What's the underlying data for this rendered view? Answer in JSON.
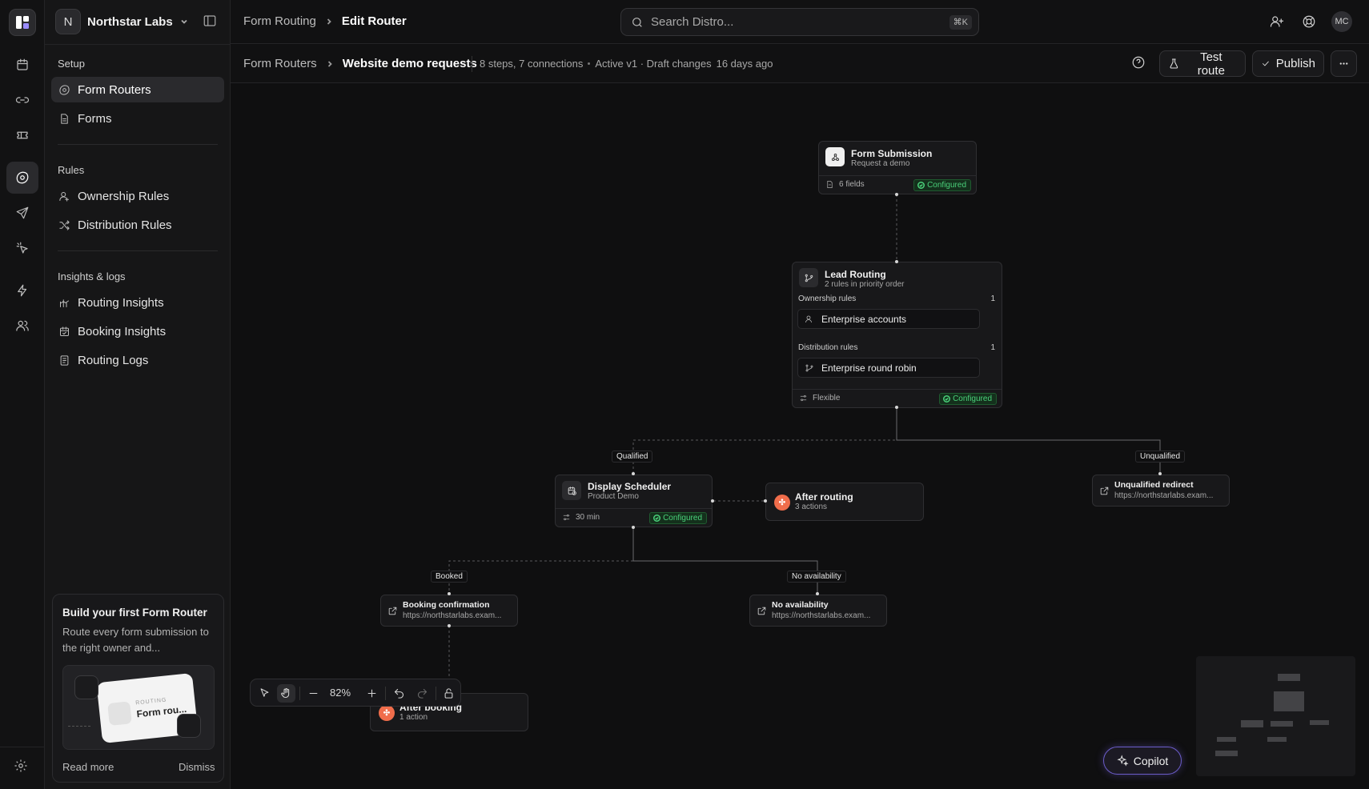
{
  "workspace": {
    "initial": "N",
    "name": "Northstar Labs"
  },
  "topbar": {
    "breadcrumb": [
      "Form Routing",
      "Edit Router"
    ],
    "search_placeholder": "Search Distro...",
    "search_shortcut": "⌘K",
    "user_initials": "MC"
  },
  "sidebar": {
    "setup_label": "Setup",
    "setup_items": [
      {
        "label": "Form Routers",
        "icon": "router-icon",
        "active": true
      },
      {
        "label": "Forms",
        "icon": "document-icon"
      }
    ],
    "rules_label": "Rules",
    "rules_items": [
      {
        "label": "Ownership Rules",
        "icon": "user-icon"
      },
      {
        "label": "Distribution Rules",
        "icon": "shuffle-icon"
      }
    ],
    "insights_label": "Insights & logs",
    "insights_items": [
      {
        "label": "Routing Insights",
        "icon": "chart-icon"
      },
      {
        "label": "Booking Insights",
        "icon": "calendar-check-icon"
      },
      {
        "label": "Routing Logs",
        "icon": "log-icon"
      }
    ],
    "promo": {
      "title": "Build your first Form Router",
      "description": "Route every form submission to the right owner and...",
      "art_tag": "ROUTING",
      "art_name": "Form rou...",
      "read_more": "Read more",
      "dismiss": "Dismiss"
    }
  },
  "subheader": {
    "breadcrumb": [
      "Form Routers",
      "Website demo requests"
    ],
    "steps": "8 steps, 7 connections",
    "status": "Active v1 · Draft changes",
    "updated": "16 days ago",
    "test_route": "Test route",
    "publish": "Publish"
  },
  "canvas": {
    "form_submission": {
      "title": "Form Submission",
      "subtitle": "Request a demo",
      "fields": "6 fields",
      "status": "Configured"
    },
    "lead_routing": {
      "title": "Lead Routing",
      "subtitle": "2 rules in priority order",
      "ownership_label": "Ownership rules",
      "ownership_count": "1",
      "ownership_rule": "Enterprise accounts",
      "distribution_label": "Distribution rules",
      "distribution_count": "1",
      "distribution_rule": "Enterprise round robin",
      "mode": "Flexible",
      "status": "Configured"
    },
    "labels": {
      "qualified": "Qualified",
      "unqualified": "Unqualified",
      "booked": "Booked",
      "no_availability": "No availability"
    },
    "display_scheduler": {
      "title": "Display Scheduler",
      "subtitle": "Product Demo",
      "duration": "30 min",
      "status": "Configured"
    },
    "after_routing": {
      "title": "After routing",
      "subtitle": "3 actions"
    },
    "unqualified_redirect": {
      "title": "Unqualified redirect",
      "url": "https://northstarlabs.exam..."
    },
    "booking_confirmation": {
      "title": "Booking confirmation",
      "url": "https://northstarlabs.exam..."
    },
    "no_availability": {
      "title": "No availability",
      "url": "https://northstarlabs.exam..."
    },
    "after_booking": {
      "title": "After booking",
      "subtitle": "1 action"
    }
  },
  "toolbar": {
    "zoom": "82%"
  },
  "copilot": {
    "label": "Copilot"
  },
  "colors": {
    "configured": "#4ad07a",
    "hubspot": "#f06d4b",
    "copilot_border": "#6b5cc8"
  }
}
